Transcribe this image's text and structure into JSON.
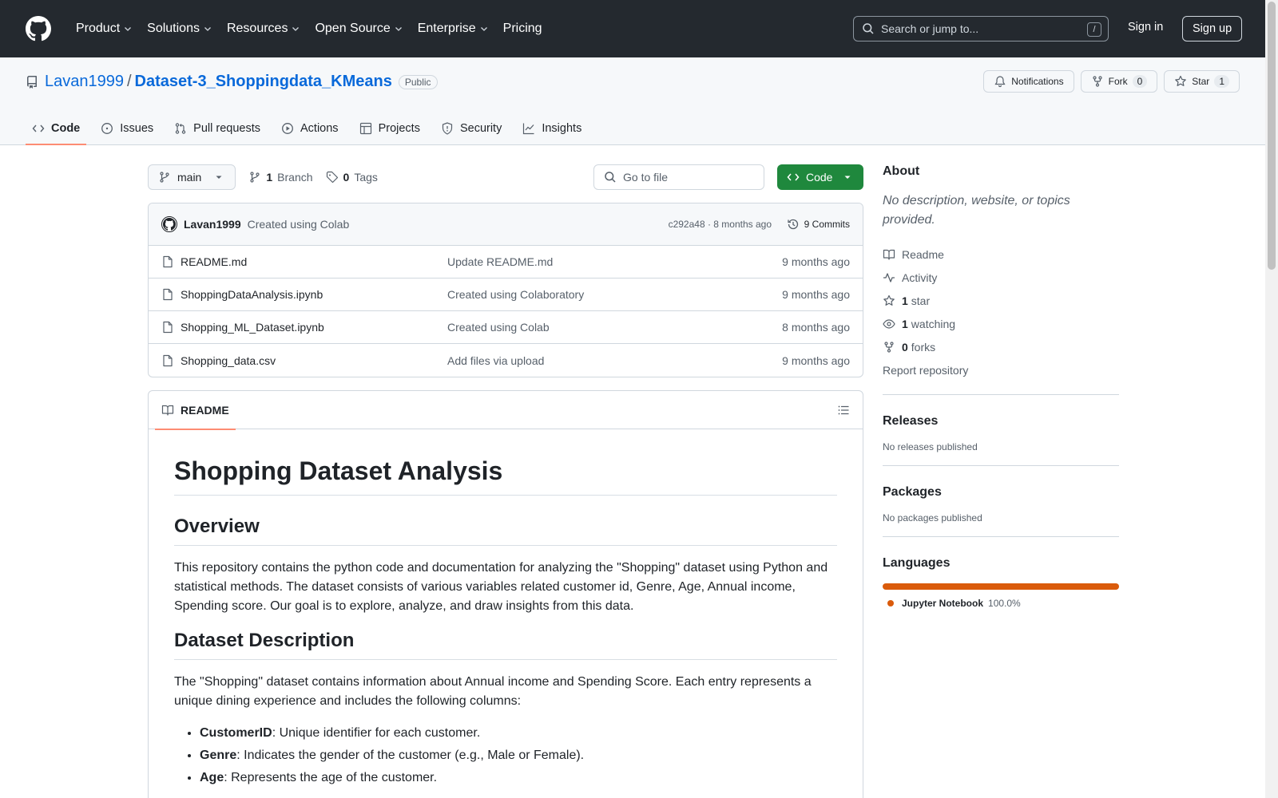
{
  "colors": {
    "header_bg": "#24292f",
    "link": "#0969da",
    "green": "#1f883d",
    "tab_underline": "#fd8c73",
    "jupyter": "#DA5B0B"
  },
  "topnav": {
    "items": [
      "Product",
      "Solutions",
      "Resources",
      "Open Source",
      "Enterprise",
      "Pricing"
    ],
    "search_placeholder": "Search or jump to...",
    "search_shortcut": "/",
    "signin": "Sign in",
    "signup": "Sign up"
  },
  "repo": {
    "owner": "Lavan1999",
    "separator": "/",
    "name": "Dataset-3_Shoppingdata_KMeans",
    "visibility": "Public",
    "notifications": "Notifications",
    "fork_label": "Fork",
    "fork_count": "0",
    "star_label": "Star",
    "star_count": "1",
    "tabs": [
      "Code",
      "Issues",
      "Pull requests",
      "Actions",
      "Projects",
      "Security",
      "Insights"
    ]
  },
  "toolbar": {
    "branch": "main",
    "branch_count": "1",
    "branch_label": "Branch",
    "tag_count": "0",
    "tag_label": "Tags",
    "goto_placeholder": "Go to file",
    "code_button": "Code"
  },
  "commit": {
    "author": "Lavan1999",
    "message": "Created using Colab",
    "meta": "c292a48 · 8 months ago",
    "commits": "9 Commits"
  },
  "files": [
    {
      "name": "README.md",
      "message": "Update README.md",
      "age": "9 months ago"
    },
    {
      "name": "ShoppingDataAnalysis.ipynb",
      "message": "Created using Colaboratory",
      "age": "9 months ago"
    },
    {
      "name": "Shopping_ML_Dataset.ipynb",
      "message": "Created using Colab",
      "age": "8 months ago"
    },
    {
      "name": "Shopping_data.csv",
      "message": "Add files via upload",
      "age": "9 months ago"
    }
  ],
  "readme": {
    "tab": "README",
    "h1": "Shopping Dataset Analysis",
    "h2_overview": "Overview",
    "overview": "This repository contains the python code and documentation for analyzing the \"Shopping\" dataset using Python and statistical methods. The dataset consists of various variables related customer id, Genre, Age, Annual income, Spending score. Our goal is to explore, analyze, and draw insights from this data.",
    "h2_dataset": "Dataset Description",
    "dataset": "The \"Shopping\" dataset contains information about Annual income and Spending Score. Each entry represents a unique dining experience and includes the following columns:",
    "columns": [
      {
        "name": "CustomerID",
        "desc": ": Unique identifier for each customer."
      },
      {
        "name": "Genre",
        "desc": ": Indicates the gender of the customer (e.g., Male or Female)."
      },
      {
        "name": "Age",
        "desc": ": Represents the age of the customer."
      }
    ]
  },
  "sidebar": {
    "about_title": "About",
    "about_desc": "No description, website, or topics provided.",
    "readme": "Readme",
    "activity": "Activity",
    "stars_count": "1",
    "stars_label": "star",
    "watching_count": "1",
    "watching_label": "watching",
    "forks_count": "0",
    "forks_label": "forks",
    "report": "Report repository",
    "releases_title": "Releases",
    "releases_empty": "No releases published",
    "packages_title": "Packages",
    "packages_empty": "No packages published",
    "languages_title": "Languages",
    "language_name": "Jupyter Notebook",
    "language_pct": "100.0%"
  }
}
